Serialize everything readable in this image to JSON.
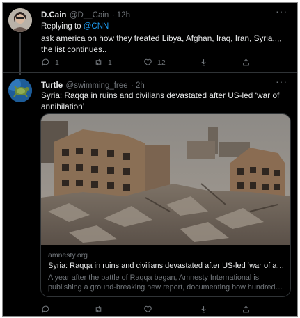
{
  "tweet1": {
    "name": "D.Cain",
    "handle": "@D__Cain",
    "time": "· 12h",
    "replying_prefix": "Replying to ",
    "replying_to": "@CNN",
    "text": "ask america on how they treated Libya, Afghan, Iraq, Iran, Syria,,,, the list continues..",
    "replies": "1",
    "retweets": "1",
    "likes": "12"
  },
  "tweet2": {
    "name": "Turtle",
    "handle": "@swimming_free",
    "time": "· 2h",
    "text": "Syria: Raqqa in ruins and civilians devastated after US-led ‘war of annihilation’",
    "card": {
      "domain": "amnesty.org",
      "title": "Syria: Raqqa in ruins and civilians devastated after US-led ‘war of anni...",
      "desc_line1": "A year after the battle of Raqqa began, Amnesty International is",
      "desc_line2": "publishing a ground-breaking new report, documenting how hundreds ..."
    }
  },
  "icons": [
    "more-icon",
    "reply-icon",
    "retweet-icon",
    "like-icon",
    "download-icon",
    "share-icon"
  ],
  "colors": {
    "background": "#000000",
    "text": "#e7e9ea",
    "muted": "#71767b",
    "link": "#1d9bf0"
  }
}
